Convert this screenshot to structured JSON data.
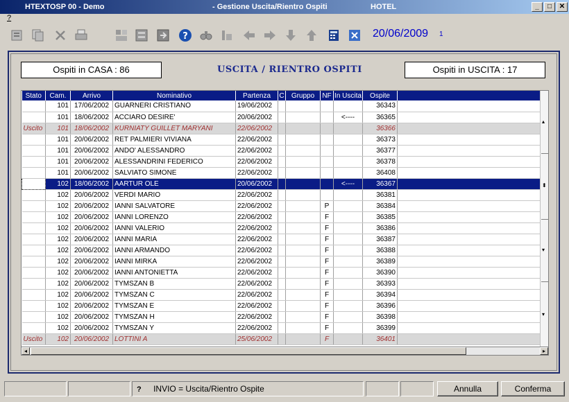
{
  "window": {
    "title_left": "HTEXTOSP 00 - Demo",
    "title_center": "- Gestione Uscita/Rientro Ospiti",
    "title_right": "HOTEL",
    "minimize": "_",
    "maximize": "□",
    "close": "✕"
  },
  "menu": {
    "help": "?"
  },
  "toolbar": {
    "icons": [
      "record-icon",
      "copy-record-icon",
      "delete-icon",
      "print-icon",
      "layout-icon",
      "form-icon",
      "export-icon",
      "help-icon",
      "find-icon",
      "chart-icon",
      "prev-icon",
      "next-icon",
      "down-icon",
      "up-icon",
      "calculator-icon",
      "close-icon"
    ],
    "date": "20/06/2009",
    "count": "1"
  },
  "header": {
    "casa_label": "Ospiti in CASA :  86",
    "title": "USCITA / RIENTRO OSPITI",
    "uscita_label": "Ospiti in USCITA :  17"
  },
  "table": {
    "columns": [
      "Stato",
      "Cam.",
      "Arrivo",
      "Nominativo",
      "Partenza",
      "C",
      "Gruppo",
      "NF",
      "In Uscita",
      "Ospite"
    ],
    "rows": [
      [
        "",
        "101",
        "17/06/2002",
        "GUARNERI CRISTIANO",
        "19/06/2002",
        "",
        "",
        "",
        "",
        "36343"
      ],
      [
        "",
        "101",
        "18/06/2002",
        "ACCIARO DESIRE'",
        "20/06/2002",
        "",
        "",
        "",
        "<----",
        "36365"
      ],
      [
        "Uscito",
        "101",
        "18/06/2002",
        "KURNIATY GUILLET MARYANI",
        "22/06/2002",
        "",
        "",
        "",
        "",
        "36366"
      ],
      [
        "",
        "101",
        "20/06/2002",
        "RET PALMIERI VIVIANA",
        "22/06/2002",
        "",
        "",
        "",
        "",
        "36373"
      ],
      [
        "",
        "101",
        "20/06/2002",
        "ANDO' ALESSANDRO",
        "22/06/2002",
        "",
        "",
        "",
        "",
        "36377"
      ],
      [
        "",
        "101",
        "20/06/2002",
        "ALESSANDRINI FEDERICO",
        "22/06/2002",
        "",
        "",
        "",
        "",
        "36378"
      ],
      [
        "",
        "101",
        "20/06/2002",
        "SALVIATO SIMONE",
        "22/06/2002",
        "",
        "",
        "",
        "",
        "36408"
      ],
      [
        "",
        "102",
        "18/06/2002",
        "AARTUR OLE",
        "20/06/2002",
        "",
        "",
        "",
        "<----",
        "36367"
      ],
      [
        "",
        "102",
        "20/06/2002",
        "VERDI MARIO",
        "22/06/2002",
        "",
        "",
        "",
        "",
        "36381"
      ],
      [
        "",
        "102",
        "20/06/2002",
        "IANNI SALVATORE",
        "22/06/2002",
        "",
        "",
        "P",
        "",
        "36384"
      ],
      [
        "",
        "102",
        "20/06/2002",
        "IANNI LORENZO",
        "22/06/2002",
        "",
        "",
        "F",
        "",
        "36385"
      ],
      [
        "",
        "102",
        "20/06/2002",
        "IANNI VALERIO",
        "22/06/2002",
        "",
        "",
        "F",
        "",
        "36386"
      ],
      [
        "",
        "102",
        "20/06/2002",
        "IANNI MARIA",
        "22/06/2002",
        "",
        "",
        "F",
        "",
        "36387"
      ],
      [
        "",
        "102",
        "20/06/2002",
        "IANNI ARMANDO",
        "22/06/2002",
        "",
        "",
        "F",
        "",
        "36388"
      ],
      [
        "",
        "102",
        "20/06/2002",
        "IANNI MIRKA",
        "22/06/2002",
        "",
        "",
        "F",
        "",
        "36389"
      ],
      [
        "",
        "102",
        "20/06/2002",
        "IANNI ANTONIETTA",
        "22/06/2002",
        "",
        "",
        "F",
        "",
        "36390"
      ],
      [
        "",
        "102",
        "20/06/2002",
        "TYMSZAN B",
        "22/06/2002",
        "",
        "",
        "F",
        "",
        "36393"
      ],
      [
        "",
        "102",
        "20/06/2002",
        "TYMSZAN C",
        "22/06/2002",
        "",
        "",
        "F",
        "",
        "36394"
      ],
      [
        "",
        "102",
        "20/06/2002",
        "TYMSZAN E",
        "22/06/2002",
        "",
        "",
        "F",
        "",
        "36396"
      ],
      [
        "",
        "102",
        "20/06/2002",
        "TYMSZAN H",
        "22/06/2002",
        "",
        "",
        "F",
        "",
        "36398"
      ],
      [
        "",
        "102",
        "20/06/2002",
        "TYMSZAN Y",
        "22/06/2002",
        "",
        "",
        "F",
        "",
        "36399"
      ],
      [
        "Uscito",
        "102",
        "20/06/2002",
        "LOTTINI A",
        "25/06/2002",
        "",
        "",
        "F",
        "",
        "36401"
      ]
    ],
    "uscito_rows": [
      2,
      21
    ],
    "selected_row": 7
  },
  "status": {
    "help_icon": "?",
    "hint": "INVIO = Uscita/Rientro Ospite",
    "annulla": "Annulla",
    "conferma": "Conferma"
  },
  "colors": {
    "selection": "#0a1c86",
    "uscito_text": "#a03030",
    "date": "#0000cc"
  }
}
